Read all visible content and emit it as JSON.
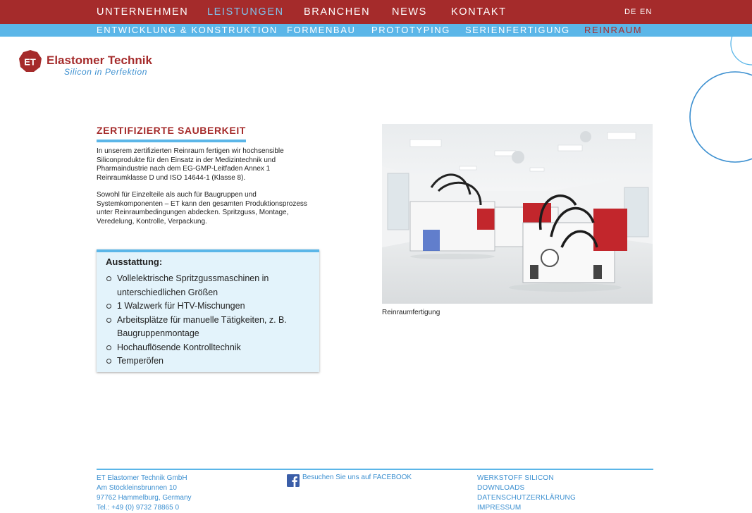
{
  "nav": {
    "items": [
      "UNTERNEHMEN",
      "LEISTUNGEN",
      "BRANCHEN",
      "NEWS",
      "KONTAKT"
    ],
    "active": "LEISTUNGEN",
    "lang": [
      "DE",
      "EN"
    ]
  },
  "subnav": {
    "items": [
      "ENTWICKLUNG & KONSTRUKTION",
      "FORMENBAU",
      "PROTOTYPING",
      "SERIENFERTIGUNG",
      "REINRAUM"
    ],
    "active": "REINRAUM"
  },
  "logo": {
    "mark": "ET",
    "name": "Elastomer Technik",
    "tagline": "Silicon in Perfektion"
  },
  "content": {
    "headline": "ZERTIFIZIERTE SAUBERKEIT",
    "paragraph1": "In unserem zertifizierten Reinraum fertigen wir hochsensible Siliconprodukte für den Einsatz in der Medizintechnik und Pharmaindustrie nach dem EG-GMP-Leitfaden Annex 1 Reinraumklasse D und ISO 14644-1 (Klasse 8).",
    "paragraph2": "Sowohl für Einzelteile als auch für Baugruppen und Systemkomponenten – ET kann den gesamten Produktionsprozess unter Reinraumbedingungen abdecken. Spritzguss, Montage, Veredelung, Kontrolle, Verpackung.",
    "equipment_title": "Ausstattung:",
    "equipment": [
      "Vollelektrische Spritzgussmaschinen in unterschiedlichen Größen",
      "1 Walzwerk für HTV-Mischungen",
      "Arbeitsplätze für manuelle Tätigkeiten, z. B. Baugruppenmontage",
      "Hochauflösende Kontrolltechnik",
      "Temperöfen"
    ],
    "photo_caption": "Reinraumfertigung"
  },
  "footer": {
    "address": [
      "ET Elastomer Technik GmbH",
      "Am Stöckleinsbrunnen 10",
      "97762 Hammelburg, Germany",
      "Tel.: +49 (0) 9732 78865 0"
    ],
    "facebook_label": "Besuchen Sie uns auf FACEBOOK",
    "links": [
      "WERKSTOFF SILICON",
      "DOWNLOADS",
      "DATENSCHUTZERKLÄRUNG",
      "IMPRESSUM"
    ]
  },
  "colors": {
    "brand_red": "#a52b2b",
    "accent_blue": "#5bb6e8",
    "link_blue": "#3b8fd0",
    "panel_bg": "#e3f3fb"
  }
}
